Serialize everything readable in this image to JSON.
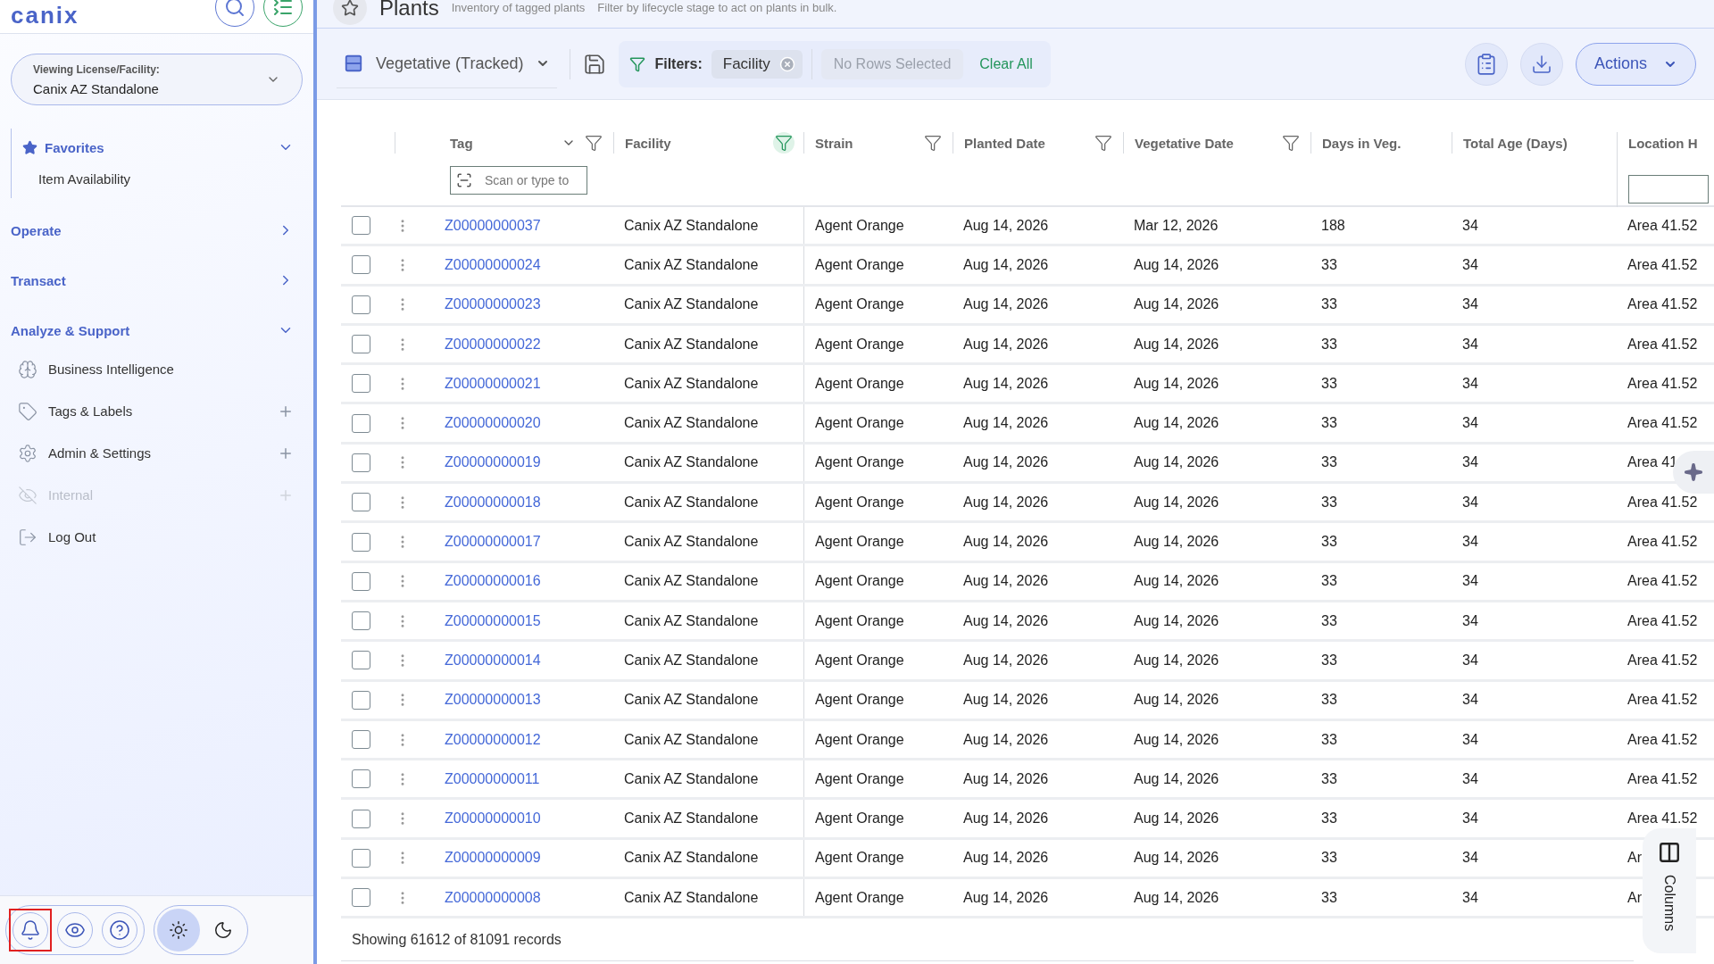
{
  "sidebar": {
    "logo": "canix",
    "facility_selector": {
      "label": "Viewing License/Facility:",
      "value": "Canix AZ Standalone"
    },
    "nav": [
      {
        "kind": "favorites",
        "label": "Favorites",
        "expanded": true,
        "children": [
          {
            "label": "Item Availability"
          }
        ]
      },
      {
        "kind": "section",
        "label": "Operate",
        "expanded": false
      },
      {
        "kind": "section",
        "label": "Transact",
        "expanded": false
      },
      {
        "kind": "section",
        "label": "Analyze & Support",
        "expanded": true,
        "children": [
          {
            "label": "Business Intelligence",
            "addable": false,
            "disabled": false
          },
          {
            "label": "Tags & Labels",
            "addable": true,
            "disabled": false
          },
          {
            "label": "Admin & Settings",
            "addable": true,
            "disabled": false
          },
          {
            "label": "Internal",
            "addable": true,
            "disabled": true
          },
          {
            "label": "Log Out",
            "addable": false,
            "disabled": false
          }
        ]
      }
    ],
    "bottom_buttons": [
      {
        "highlighted": true
      },
      {
        "highlighted": false
      },
      {
        "highlighted": false
      }
    ],
    "theme_toggle": [
      {
        "selected": true
      },
      {
        "selected": false
      }
    ]
  },
  "header": {
    "title": "Plants",
    "subtitles": [
      "Inventory of tagged plants",
      "Filter by lifecycle stage to act on plants in bulk."
    ]
  },
  "toolbar": {
    "view": "Vegetative (Tracked)",
    "filters_label": "Filters:",
    "filter_chips": [
      {
        "label": "Facility"
      }
    ],
    "selection": "No Rows Selected",
    "clear": "Clear All",
    "actions": "Actions"
  },
  "table": {
    "columns": [
      {
        "label": "Tag",
        "sortable": true,
        "filter": true,
        "filter_active": false,
        "placeholder": "Scan or type to"
      },
      {
        "label": "Facility",
        "sortable": false,
        "filter": true,
        "filter_active": true
      },
      {
        "label": "Strain",
        "sortable": false,
        "filter": true,
        "filter_active": false
      },
      {
        "label": "Planted Date",
        "sortable": false,
        "filter": true,
        "filter_active": false
      },
      {
        "label": "Vegetative Date",
        "sortable": false,
        "filter": true,
        "filter_active": false
      },
      {
        "label": "Days in Veg.",
        "sortable": false,
        "filter": false
      },
      {
        "label": "Total Age (Days)",
        "sortable": false,
        "filter": false
      },
      {
        "label": "Location H",
        "sortable": false,
        "filter": false,
        "input": true
      }
    ],
    "rows": [
      {
        "checked": false,
        "cells": [
          "Z00000000037",
          "Canix AZ Standalone",
          "Agent Orange",
          "Aug 14, 2026",
          "Mar 12, 2026",
          "188",
          "34",
          "Area 41.52"
        ]
      },
      {
        "checked": false,
        "cells": [
          "Z00000000024",
          "Canix AZ Standalone",
          "Agent Orange",
          "Aug 14, 2026",
          "Aug 14, 2026",
          "33",
          "34",
          "Area 41.52"
        ]
      },
      {
        "checked": false,
        "cells": [
          "Z00000000023",
          "Canix AZ Standalone",
          "Agent Orange",
          "Aug 14, 2026",
          "Aug 14, 2026",
          "33",
          "34",
          "Area 41.52"
        ]
      },
      {
        "checked": false,
        "cells": [
          "Z00000000022",
          "Canix AZ Standalone",
          "Agent Orange",
          "Aug 14, 2026",
          "Aug 14, 2026",
          "33",
          "34",
          "Area 41.52"
        ]
      },
      {
        "checked": false,
        "cells": [
          "Z00000000021",
          "Canix AZ Standalone",
          "Agent Orange",
          "Aug 14, 2026",
          "Aug 14, 2026",
          "33",
          "34",
          "Area 41.52"
        ]
      },
      {
        "checked": false,
        "cells": [
          "Z00000000020",
          "Canix AZ Standalone",
          "Agent Orange",
          "Aug 14, 2026",
          "Aug 14, 2026",
          "33",
          "34",
          "Area 41.52"
        ]
      },
      {
        "checked": false,
        "cells": [
          "Z00000000019",
          "Canix AZ Standalone",
          "Agent Orange",
          "Aug 14, 2026",
          "Aug 14, 2026",
          "33",
          "34",
          "Area 41"
        ]
      },
      {
        "checked": false,
        "cells": [
          "Z00000000018",
          "Canix AZ Standalone",
          "Agent Orange",
          "Aug 14, 2026",
          "Aug 14, 2026",
          "33",
          "34",
          "Area 41.52"
        ]
      },
      {
        "checked": false,
        "cells": [
          "Z00000000017",
          "Canix AZ Standalone",
          "Agent Orange",
          "Aug 14, 2026",
          "Aug 14, 2026",
          "33",
          "34",
          "Area 41.52"
        ]
      },
      {
        "checked": false,
        "cells": [
          "Z00000000016",
          "Canix AZ Standalone",
          "Agent Orange",
          "Aug 14, 2026",
          "Aug 14, 2026",
          "33",
          "34",
          "Area 41.52"
        ]
      },
      {
        "checked": false,
        "cells": [
          "Z00000000015",
          "Canix AZ Standalone",
          "Agent Orange",
          "Aug 14, 2026",
          "Aug 14, 2026",
          "33",
          "34",
          "Area 41.52"
        ]
      },
      {
        "checked": false,
        "cells": [
          "Z00000000014",
          "Canix AZ Standalone",
          "Agent Orange",
          "Aug 14, 2026",
          "Aug 14, 2026",
          "33",
          "34",
          "Area 41.52"
        ]
      },
      {
        "checked": false,
        "cells": [
          "Z00000000013",
          "Canix AZ Standalone",
          "Agent Orange",
          "Aug 14, 2026",
          "Aug 14, 2026",
          "33",
          "34",
          "Area 41.52"
        ]
      },
      {
        "checked": false,
        "cells": [
          "Z00000000012",
          "Canix AZ Standalone",
          "Agent Orange",
          "Aug 14, 2026",
          "Aug 14, 2026",
          "33",
          "34",
          "Area 41.52"
        ]
      },
      {
        "checked": false,
        "cells": [
          "Z00000000011",
          "Canix AZ Standalone",
          "Agent Orange",
          "Aug 14, 2026",
          "Aug 14, 2026",
          "33",
          "34",
          "Area 41.52"
        ]
      },
      {
        "checked": false,
        "cells": [
          "Z00000000010",
          "Canix AZ Standalone",
          "Agent Orange",
          "Aug 14, 2026",
          "Aug 14, 2026",
          "33",
          "34",
          "Area 41.52"
        ]
      },
      {
        "checked": false,
        "cells": [
          "Z00000000009",
          "Canix AZ Standalone",
          "Agent Orange",
          "Aug 14, 2026",
          "Aug 14, 2026",
          "33",
          "34",
          "Ar"
        ]
      },
      {
        "checked": false,
        "cells": [
          "Z00000000008",
          "Canix AZ Standalone",
          "Agent Orange",
          "Aug 14, 2026",
          "Aug 14, 2026",
          "33",
          "34",
          "Ar"
        ]
      }
    ],
    "footer": "Showing 61612 of 81091 records"
  },
  "columns_panel": {
    "label": "Columns"
  }
}
